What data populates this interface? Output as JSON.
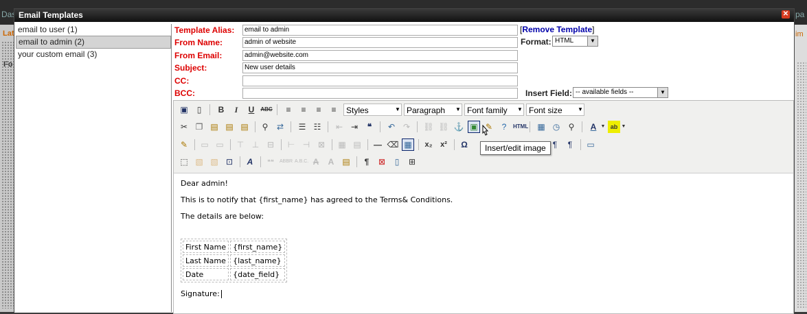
{
  "window": {
    "title": "Email Templates"
  },
  "templates": [
    {
      "label": "email to user (1)"
    },
    {
      "label": "email to admin (2)"
    },
    {
      "label": "your custom email (3)"
    }
  ],
  "form": {
    "alias_label": "Template Alias:",
    "alias_value": "email to admin",
    "from_name_label": "From Name:",
    "from_name_value": "admin of website",
    "from_email_label": "From Email:",
    "from_email_value": "admin@website.com",
    "subject_label": "Subject:",
    "subject_value": "New user details",
    "cc_label": "CC:",
    "cc_value": "",
    "bcc_label": "BCC:",
    "bcc_value": "",
    "remove_open": "[",
    "remove_link": "Remove Template",
    "remove_close": "]",
    "format_label": "Format:",
    "format_value": "HTML",
    "insert_field_label": "Insert Field:",
    "insert_field_value": "-- available fields --"
  },
  "toolbar": {
    "styles": "Styles",
    "paragraph": "Paragraph",
    "font_family": "Font family",
    "font_size": "Font size",
    "tooltip": "Insert/edit image",
    "html_button": "HTML"
  },
  "content": {
    "greeting": "Dear admin!",
    "line1": "This is to notify that {first_name} has agreed to the Terms& Conditions.",
    "line2": "The details are below:",
    "table": [
      {
        "label": "First Name",
        "value": "{first_name}"
      },
      {
        "label": "Last Name",
        "value": "{last_name}"
      },
      {
        "label": "Date",
        "value": "{date_field}"
      }
    ],
    "signature": "Signature:"
  },
  "background": {
    "top_left": "Das",
    "side_left": "Lat",
    "side_left2": "Fo",
    "top_right": "pa",
    "side_right": "im"
  },
  "colors": {
    "label_red": "#dd0000",
    "link_blue": "#0000aa",
    "titlebar": "#1a1a1a"
  }
}
